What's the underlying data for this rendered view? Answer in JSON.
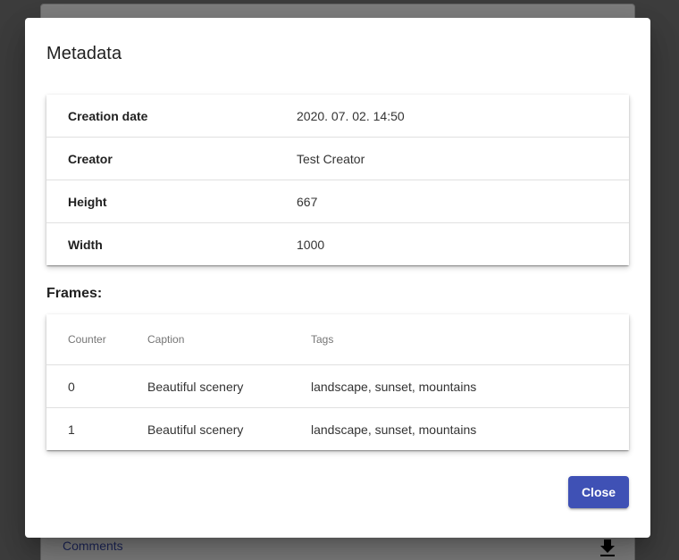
{
  "background": {
    "comments_link": "Comments",
    "download_icon": "download-icon"
  },
  "dialog": {
    "title": "Metadata",
    "metadata": [
      {
        "key": "Creation date",
        "value": "2020. 07. 02. 14:50"
      },
      {
        "key": "Creator",
        "value": "Test Creator"
      },
      {
        "key": "Height",
        "value": "667"
      },
      {
        "key": "Width",
        "value": "1000"
      }
    ],
    "frames_heading": "Frames:",
    "frames_columns": {
      "counter": "Counter",
      "caption": "Caption",
      "tags": "Tags"
    },
    "frames": [
      {
        "counter": "0",
        "caption": "Beautiful scenery",
        "tags": "landscape, sunset, mountains"
      },
      {
        "counter": "1",
        "caption": "Beautiful scenery",
        "tags": "landscape, sunset, mountains"
      }
    ],
    "close_label": "Close"
  },
  "colors": {
    "accent": "#3f51b5",
    "overlay": "rgba(0,0,0,0.5)"
  }
}
